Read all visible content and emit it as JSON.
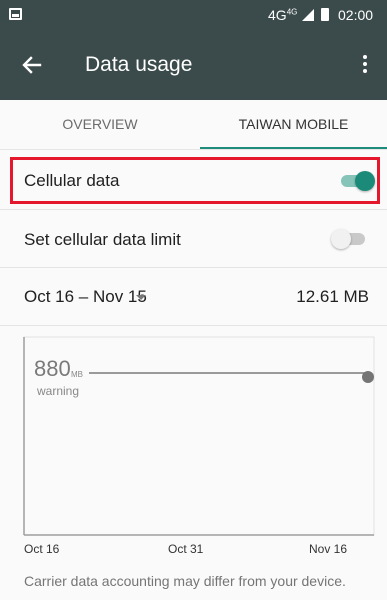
{
  "status_bar": {
    "network": "4G",
    "network_badge": "4G",
    "time": "02:00"
  },
  "app_bar": {
    "title": "Data usage"
  },
  "tabs": [
    {
      "label": "OVERVIEW",
      "selected": false
    },
    {
      "label": "TAIWAN MOBILE",
      "selected": true
    }
  ],
  "settings": {
    "cellular_data": {
      "label": "Cellular data",
      "enabled": true
    },
    "data_limit": {
      "label": "Set cellular data limit",
      "enabled": false
    }
  },
  "cycle": {
    "range": "Oct 16 – Nov 15",
    "usage": "12.61 MB"
  },
  "chart_data": {
    "type": "line",
    "warning": {
      "value": "880",
      "unit": "MB",
      "label": "warning"
    },
    "x_ticks": [
      "Oct 16",
      "Oct 31",
      "Nov 16"
    ],
    "series": []
  },
  "footer": {
    "note": "Carrier data accounting may differ from your device."
  },
  "colors": {
    "app_bar": "#3b4a4a",
    "accent": "#1f8c7c",
    "highlight_box": "#e4172d"
  }
}
